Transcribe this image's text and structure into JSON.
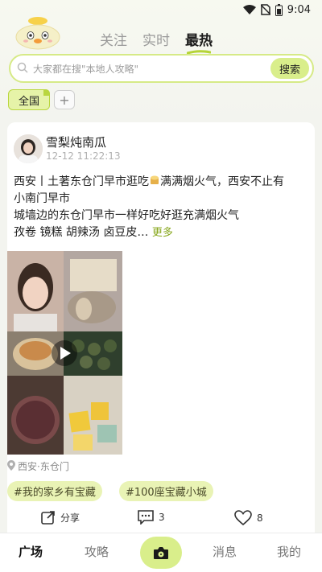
{
  "status_bar": {
    "time": "9:04"
  },
  "header": {
    "tabs": [
      {
        "label": "关注"
      },
      {
        "label": "实时"
      },
      {
        "label": "最热"
      }
    ],
    "active_tab": "最热"
  },
  "search": {
    "placeholder": "大家都在搜\"本地人攻略\"",
    "button_label": "搜索"
  },
  "filters": {
    "all_label": "全国",
    "add_label": "+"
  },
  "post": {
    "username": "雪梨炖南瓜",
    "time": "12-12 11:22:13",
    "text_line1": "西安丨土著东仓门早市逛吃",
    "text_line1b": "满满烟火气，西安不止有",
    "text_line2": "小南门早市",
    "text_line3": "城墙边的东仓门早市一样好吃好逛充满烟火气",
    "text_line4": "孜卷 镜糕 胡辣汤 卤豆皮…",
    "more_label": "更多",
    "location": "西安·东仓门",
    "tags": [
      "#我的家乡有宝藏",
      "#100座宝藏小城"
    ],
    "share_label": "分享",
    "comment_count": "3",
    "like_count": "8"
  },
  "bottom_nav": {
    "items": [
      "广场",
      "攻略",
      "消息",
      "我的"
    ],
    "active": "广场"
  },
  "colors": {
    "accent": "#d9ee8b",
    "accent_border": "#d6ea86",
    "tag_bg": "#e9f3b5",
    "more_link": "#86a61a"
  }
}
